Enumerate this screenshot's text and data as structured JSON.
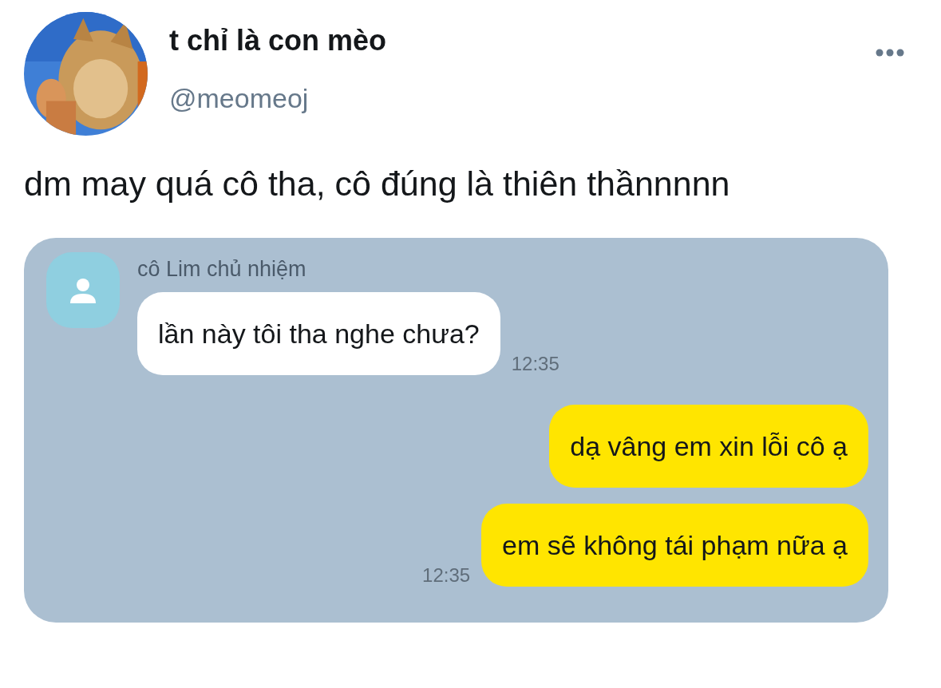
{
  "tweet": {
    "author": {
      "name": "t chỉ là con mèo",
      "handle": "@meomeoj"
    },
    "text": "dm may quá cô tha, cô đúng là thiên thầnnnnn",
    "chat": {
      "contact": "cô Lim chủ nhiệm",
      "messages": [
        {
          "kind": "received",
          "text": "lần này tôi tha nghe chưa?",
          "time": "12:35"
        },
        {
          "kind": "sent",
          "text": "dạ vâng em xin lỗi cô ạ"
        },
        {
          "kind": "sent",
          "text": "em sẽ không tái phạm nữa ạ",
          "time": "12:35"
        }
      ]
    }
  }
}
